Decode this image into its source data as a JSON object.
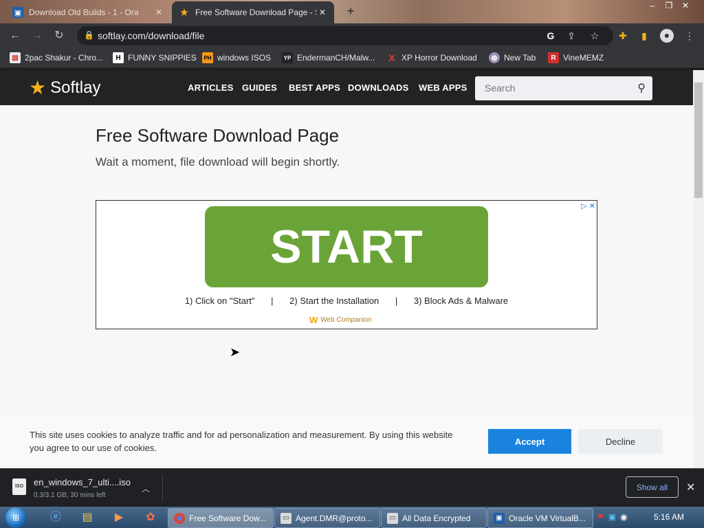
{
  "tabs": [
    {
      "title": "Download Old Builds - 1 - Ora",
      "close": "✕",
      "icon": "virtualbox-icon"
    },
    {
      "title": "Free Software Download Page - S",
      "close": "✕",
      "icon": "star-icon"
    }
  ],
  "new_tab": "+",
  "window_controls": [
    "–",
    "❐",
    "✕"
  ],
  "address": {
    "url": "softlay.com/download/file"
  },
  "bookmarks": [
    {
      "label": "2pac Shakur - Chro...",
      "icon": "chrome-store-icon",
      "badge": "▤"
    },
    {
      "label": "FUNNY SNIPPIES",
      "icon": "h-icon",
      "badge": "H"
    },
    {
      "label": "windows ISOS",
      "icon": "ph-icon",
      "badge": "PH"
    },
    {
      "label": "EndermanCH/Malw...",
      "icon": "yp-icon",
      "badge": "YP"
    },
    {
      "label": "XP Horror Download",
      "icon": "x-icon",
      "badge": "X"
    },
    {
      "label": "New Tab",
      "icon": "globe-icon",
      "badge": "◍"
    },
    {
      "label": "VineMEMZ",
      "icon": "r-icon",
      "badge": "R"
    }
  ],
  "site": {
    "logo": "Softlay",
    "nav": [
      "ARTICLES",
      "GUIDES",
      "BEST APPS",
      "DOWNLOADS",
      "WEB APPS"
    ],
    "search_placeholder": "Search"
  },
  "main": {
    "title": "Free Software Download Page",
    "subtitle": "Wait a moment, file download will begin shortly."
  },
  "ad": {
    "button": "START",
    "step1": "1) Click on \"Start\"",
    "step2": "2) Start the Installation",
    "step3": "3) Block Ads & Malware",
    "separator": "|",
    "brand": "Web Companion"
  },
  "cookie": {
    "text": "This site uses cookies to analyze traffic and for ad personalization and measurement. By using this website you agree to our use of cookies.",
    "accept": "Accept",
    "decline": "Decline"
  },
  "download": {
    "file": "en_windows_7_ulti....iso",
    "status": "0.3/3.1 GB, 30 mins left",
    "icon_label": "ISO",
    "show_all": "Show all"
  },
  "taskbar": {
    "tasks": [
      {
        "label": "Free Software Dow...",
        "icon": "chrome-icon"
      },
      {
        "label": "Agent.DMR@proto...",
        "icon": "window-icon"
      },
      {
        "label": "All Data Encrypted",
        "icon": "window-icon"
      },
      {
        "label": "Oracle VM VirtualB...",
        "icon": "virtualbox-icon"
      }
    ],
    "time": "5:16 AM"
  },
  "colors": {
    "accent_button": "#1a83e0",
    "start_green": "#6aa438",
    "logo_star": "#f4b21b"
  }
}
